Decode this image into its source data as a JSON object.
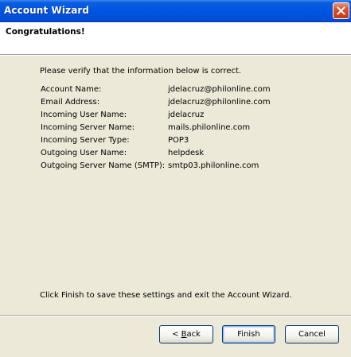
{
  "window": {
    "title": "Account Wizard",
    "close_icon": "close-icon"
  },
  "header": {
    "title": "Congratulations!"
  },
  "main": {
    "intro": "Please verify that the information below is correct.",
    "fields": [
      {
        "label": "Account Name:",
        "value": "jdelacruz@philonline.com"
      },
      {
        "label": "Email Address:",
        "value": "jdelacruz@philonline.com"
      },
      {
        "label": "Incoming User Name:",
        "value": "jdelacruz"
      },
      {
        "label": "Incoming Server Name:",
        "value": "mails.philonline.com"
      },
      {
        "label": "Incoming Server Type:",
        "value": "POP3"
      },
      {
        "label": "Outgoing User Name:",
        "value": "helpdesk"
      },
      {
        "label": "Outgoing Server Name (SMTP):",
        "value": "smtp03.philonline.com"
      }
    ],
    "finish_note": "Click Finish to save these settings and exit the Account Wizard."
  },
  "buttons": {
    "back_prefix": "< ",
    "back_mnemonic": "B",
    "back_rest": "ack",
    "finish": "Finish",
    "cancel": "Cancel"
  },
  "colors": {
    "titlebar": "#0054e3",
    "dialog_background": "#ece9d8",
    "close_button": "#d9502a"
  }
}
